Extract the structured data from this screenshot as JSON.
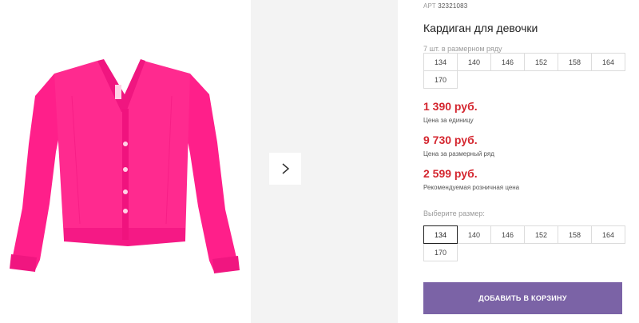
{
  "product": {
    "article_label": "АРТ",
    "article_number": "32321083",
    "title": "Кардиган для девочки",
    "image_color": "#ff1f8a"
  },
  "size_range": {
    "note": "7 шт. в размерном ряду",
    "sizes": [
      "134",
      "140",
      "146",
      "152",
      "158",
      "164",
      "170"
    ]
  },
  "prices": [
    {
      "value": "1 390 руб.",
      "label": "Цена за единицу"
    },
    {
      "value": "9 730 руб.",
      "label": "Цена за размерный ряд"
    },
    {
      "value": "2 599 руб.",
      "label": "Рекомендуемая розничная цена"
    }
  ],
  "size_picker": {
    "label": "Выберите размер:",
    "sizes": [
      "134",
      "140",
      "146",
      "152",
      "158",
      "164",
      "170"
    ],
    "selected": "134"
  },
  "cart_button": {
    "label": "ДОБАВИТЬ В КОРЗИНУ",
    "color": "#7b63a6"
  },
  "gallery": {
    "next_icon": "chevron-right-icon"
  },
  "colors": {
    "price": "#d4262f",
    "accent": "#7b63a6",
    "strip": "#f3f3f3"
  }
}
